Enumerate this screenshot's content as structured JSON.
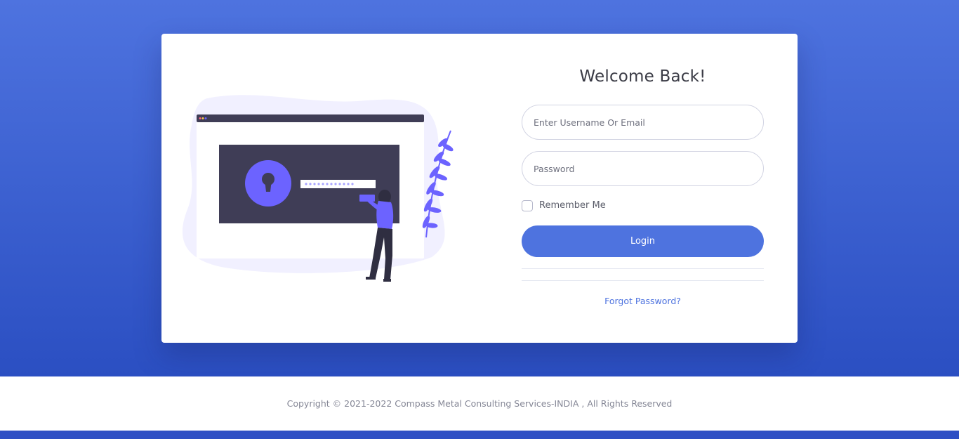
{
  "login": {
    "title": "Welcome Back!",
    "username_placeholder": "Enter Username Or Email",
    "password_placeholder": "Password",
    "remember_label": "Remember Me",
    "remember_checked": false,
    "login_label": "Login",
    "forgot_label": "Forgot Password?"
  },
  "illustration": {
    "icon": "secure-login-illustration",
    "accent_color": "#6c63ff",
    "screen_color": "#3f3d56",
    "blob_color": "#f1f0ff"
  },
  "footer": {
    "copyright": "Copyright © 2021-2022 Compass Metal Consulting Services-INDIA , All Rights Reserved"
  },
  "colors": {
    "primary": "#4e73df",
    "primary_dark": "#2b4fc2"
  }
}
